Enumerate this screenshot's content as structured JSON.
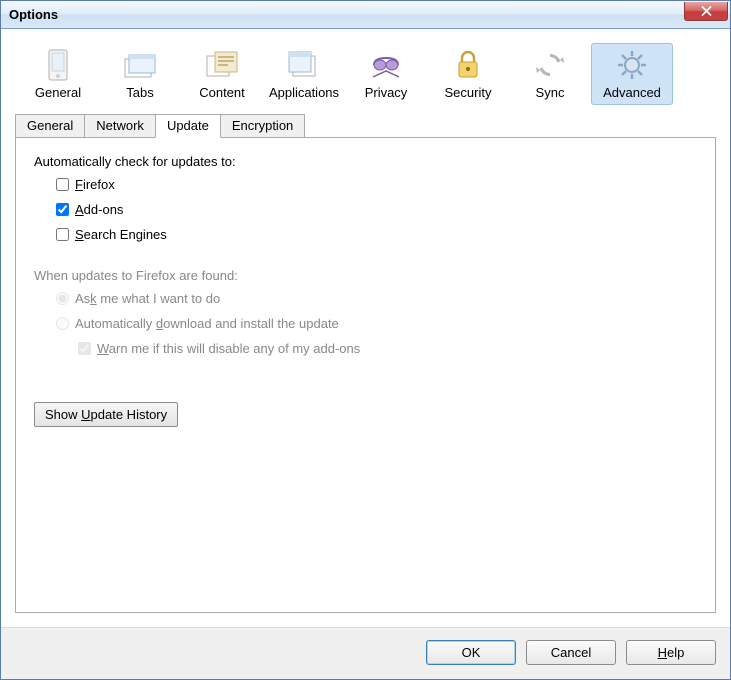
{
  "window": {
    "title": "Options"
  },
  "categories": [
    {
      "label": "General"
    },
    {
      "label": "Tabs"
    },
    {
      "label": "Content"
    },
    {
      "label": "Applications"
    },
    {
      "label": "Privacy"
    },
    {
      "label": "Security"
    },
    {
      "label": "Sync"
    },
    {
      "label": "Advanced"
    }
  ],
  "subtabs": [
    {
      "label": "General"
    },
    {
      "label": "Network"
    },
    {
      "label": "Update"
    },
    {
      "label": "Encryption"
    }
  ],
  "update": {
    "heading": "Automatically check for updates to:",
    "firefox": {
      "label_pre": "",
      "u": "F",
      "label_post": "irefox",
      "checked": false
    },
    "addons": {
      "label_pre": "",
      "u": "A",
      "label_post": "dd-ons",
      "checked": true
    },
    "search": {
      "label_pre": "",
      "u": "S",
      "label_post": "earch Engines",
      "checked": false
    },
    "found_heading": "When updates to Firefox are found:",
    "ask": {
      "pre": "As",
      "u": "k",
      "post": " me what I want to do"
    },
    "auto": {
      "pre": "Automatically ",
      "u": "d",
      "post": "ownload and install the update"
    },
    "warn": {
      "u": "W",
      "post": "arn me if this will disable any of my add-ons"
    },
    "history_btn": {
      "pre": "Show ",
      "u": "U",
      "post": "pdate History"
    }
  },
  "buttons": {
    "ok": "OK",
    "cancel": "Cancel",
    "help_u": "H",
    "help_post": "elp"
  }
}
